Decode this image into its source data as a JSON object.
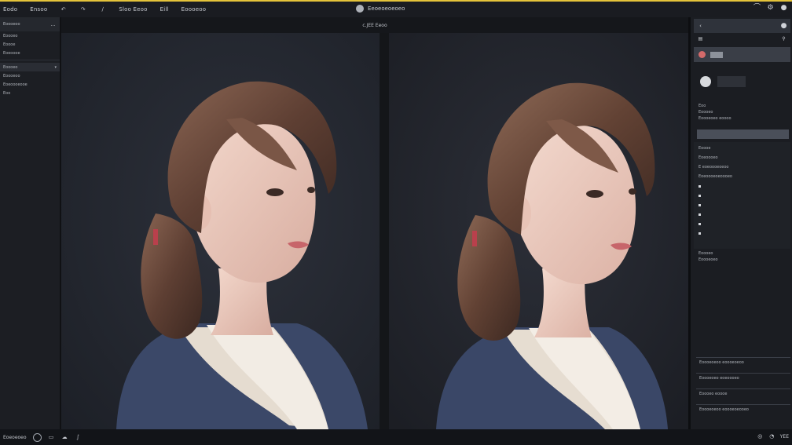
{
  "topbar": {
    "menu": [
      "Eodo",
      "Ensoo",
      "Sloo Eeoo",
      "Eill",
      "Eoooeoo"
    ],
    "center_title": "Eeoeoeoeoeo",
    "accent_color": "#e4c33a",
    "right_icons": [
      "brush-icon",
      "settings-icon",
      "account-icon"
    ]
  },
  "left_panel": {
    "header": "Eoooeoo",
    "rows": [
      "Eoooeo",
      "Eoooe",
      "Eoeoooe",
      "Eoooeo",
      "Eoooeoo",
      "Eoeoooeooe",
      "Eoo"
    ]
  },
  "canvas": {
    "title": "c.JEE Eeoo"
  },
  "right_panel": {
    "section_lines": [
      "Eoo",
      "Eoooeo",
      "Eoooeoeo eoooo"
    ],
    "list_header": "Eoooe",
    "list_items": [
      "Eoeoooeo",
      "E eoeoooeoeoo",
      "Eoeoooeoeoooeo",
      "Eoeoooeo"
    ],
    "lower_lines": [
      "Eoooeo",
      "Eoooeoeo"
    ],
    "bottom_items": [
      "Eoooeoeoo eoooeoeoo",
      "Eoooeoeo eoeoooeo",
      "Eoooeo eoooe",
      "Eoooeoeoo eoooeoeooeo"
    ]
  },
  "statusbar": {
    "left_text": "Eoeoeoeo",
    "right_text": "YEE"
  }
}
